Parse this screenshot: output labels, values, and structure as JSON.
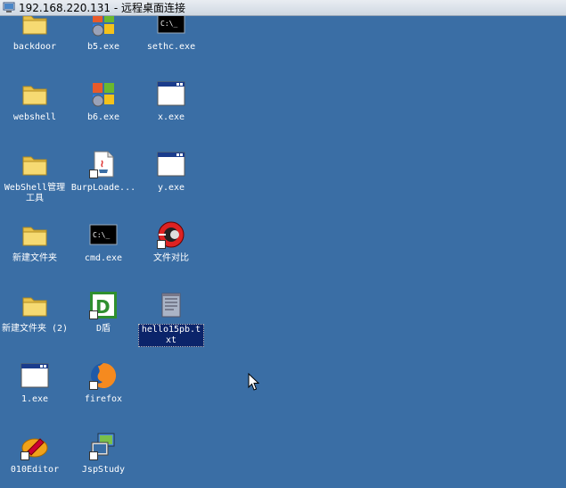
{
  "window": {
    "title": "192.168.220.131 - 远程桌面连接"
  },
  "desktop": {
    "background_color": "#3a6ea5",
    "icons": [
      {
        "label": "backdoor",
        "icon": "folder-icon"
      },
      {
        "label": "b5.exe",
        "icon": "windows-app-icon"
      },
      {
        "label": "sethc.exe",
        "icon": "cmd-icon"
      },
      {
        "label": "webshell",
        "icon": "folder-icon"
      },
      {
        "label": "b6.exe",
        "icon": "windows-app-icon"
      },
      {
        "label": "x.exe",
        "icon": "window-icon"
      },
      {
        "label": "WebShell管理工具",
        "icon": "folder-icon"
      },
      {
        "label": "BurpLoade...",
        "icon": "java-file-icon"
      },
      {
        "label": "y.exe",
        "icon": "window-icon"
      },
      {
        "label": "新建文件夹",
        "icon": "folder-icon"
      },
      {
        "label": "cmd.exe",
        "icon": "cmd-icon"
      },
      {
        "label": "文件对比",
        "icon": "compare-icon"
      },
      {
        "label": "新建文件夹 (2)",
        "icon": "folder-icon"
      },
      {
        "label": "D盾",
        "icon": "d-shield-icon"
      },
      {
        "label": "hello15pb.txt",
        "icon": "text-file-icon"
      },
      {
        "label": "1.exe",
        "icon": "window-icon"
      },
      {
        "label": "firefox",
        "icon": "firefox-icon"
      },
      {
        "label": "010Editor",
        "icon": "editor-icon"
      },
      {
        "label": "JspStudy",
        "icon": "jspstudy-icon"
      }
    ]
  }
}
